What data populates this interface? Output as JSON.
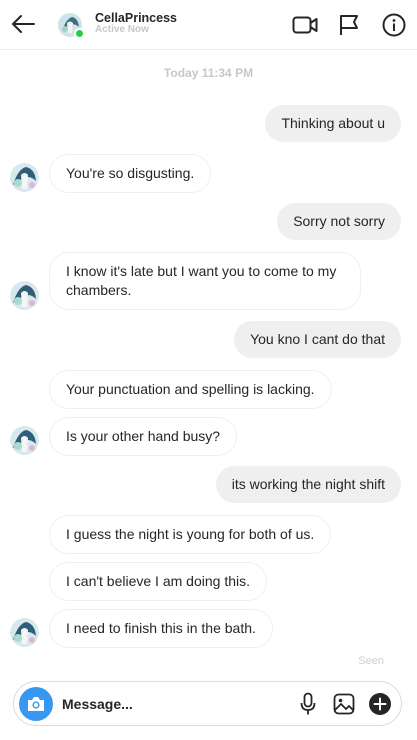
{
  "header": {
    "username": "CellaPrincess",
    "status": "Active Now"
  },
  "thread": {
    "timestamp": "Today 11:34 PM",
    "messages": [
      {
        "side": "out",
        "text": "Thinking about u"
      },
      {
        "side": "in",
        "text": "You're so disgusting."
      },
      {
        "side": "out",
        "text": "Sorry not sorry"
      },
      {
        "side": "in",
        "text": "I know it's late but I want you to come to my chambers."
      },
      {
        "side": "out",
        "text": "You kno I cant do that"
      },
      {
        "side": "in",
        "text": "Your punctuation and spelling is lacking."
      },
      {
        "side": "in",
        "text": "Is your other hand busy?"
      },
      {
        "side": "out",
        "text": "its working the night shift"
      },
      {
        "side": "in",
        "text": "I guess the night is young for both of us."
      },
      {
        "side": "in",
        "text": "I can't believe I am doing this."
      },
      {
        "side": "in",
        "text": "I need to finish this in the bath."
      }
    ],
    "seen_label": "Seen"
  },
  "composer": {
    "placeholder": "Message..."
  },
  "icons": {
    "back": "arrow-left-icon",
    "video": "video-camera-icon",
    "flag": "flag-icon",
    "info": "info-icon",
    "camera": "camera-icon",
    "mic": "microphone-icon",
    "gallery": "image-icon",
    "add": "plus-circle-icon"
  },
  "colors": {
    "accent": "#3897f0",
    "online": "#2ecc40",
    "outgoing_bubble": "#efefef"
  }
}
